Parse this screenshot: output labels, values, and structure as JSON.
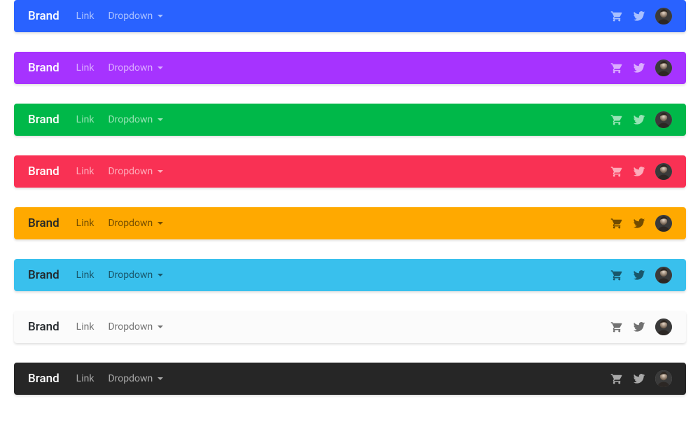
{
  "brand_label": "Brand",
  "link_label": "Link",
  "dropdown_label": "Dropdown",
  "navbars": [
    {
      "id": "primary",
      "bg": "#2962ff",
      "text": "light"
    },
    {
      "id": "secondary",
      "bg": "#a633ff",
      "text": "light"
    },
    {
      "id": "success",
      "bg": "#00b849",
      "text": "light"
    },
    {
      "id": "danger",
      "bg": "#f93154",
      "text": "light"
    },
    {
      "id": "warning",
      "bg": "#ffa900",
      "text": "dark"
    },
    {
      "id": "info",
      "bg": "#39c0ed",
      "text": "dark"
    },
    {
      "id": "light",
      "bg": "#fbfbfb",
      "text": "dark"
    },
    {
      "id": "dark",
      "bg": "#262626",
      "text": "light"
    }
  ]
}
